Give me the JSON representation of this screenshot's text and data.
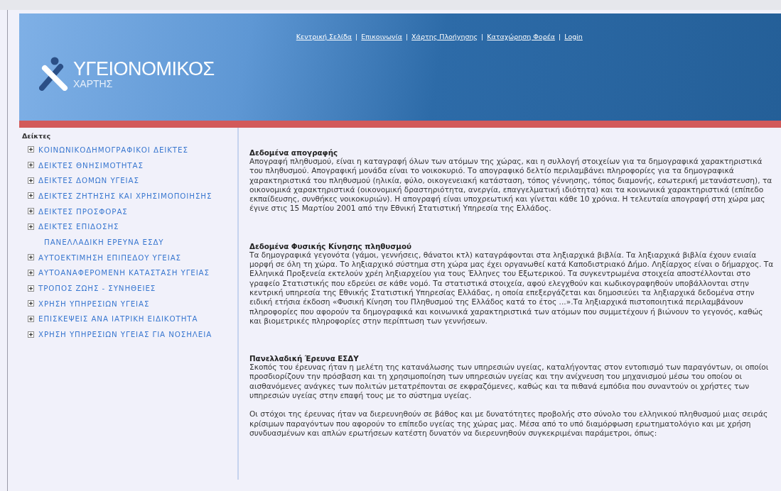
{
  "header": {
    "logo": {
      "title": "ΥΓΕΙΟΝΟΜΙΚΟΣ",
      "subtitle": "ΧΑΡΤΗΣ"
    },
    "nav": [
      {
        "label": "Κεντρική Σελίδα"
      },
      {
        "label": "Επικοινωνία"
      },
      {
        "label": "Χάρτης Πλοήγησης"
      },
      {
        "label": "Καταχώρηση Φορέα"
      },
      {
        "label": "Login"
      }
    ],
    "separator": "|"
  },
  "sidebar": {
    "title": "Δείκτες",
    "items": [
      {
        "kind": "group",
        "label": "ΚΟΙΝΩΝΙΚΟΔΗΜΟΓΡΑΦΙΚΟΙ ΔΕΙΚΤΕΣ",
        "expanded": false
      },
      {
        "kind": "group",
        "label": "ΔΕΙΚΤΕΣ ΘΝΗΣΙΜΟΤΗΤΑΣ",
        "expanded": false
      },
      {
        "kind": "group",
        "label": "ΔΕΙΚΤΕΣ ΔΟΜΩΝ ΥΓΕΙΑΣ",
        "expanded": false
      },
      {
        "kind": "group",
        "label": "ΔΕΙΚΤΕΣ ΖΗΤΗΣΗΣ ΚΑΙ ΧΡΗΣΙΜΟΠΟΙΗΣΗΣ",
        "expanded": false
      },
      {
        "kind": "group",
        "label": "ΔΕΙΚΤΕΣ ΠΡΟΣΦΟΡΑΣ",
        "expanded": false
      },
      {
        "kind": "group",
        "label": "ΔΕΙΚΤΕΣ ΕΠΙΔΟΣΗΣ",
        "expanded": false
      },
      {
        "kind": "leaf",
        "label": "ΠΑΝΕΛΛΑΔΙΚΗ ΕΡΕΥΝΑ ΕΣΔΥ"
      },
      {
        "kind": "group",
        "label": "ΑΥΤΟΕΚΤΙΜΗΣΗ ΕΠΙΠΕΔΟΥ ΥΓΕΙΑΣ",
        "expanded": false
      },
      {
        "kind": "group",
        "label": "ΑΥΤΟΑΝΑΦΕΡΟΜΕΝΗ ΚΑΤΑΣΤΑΣΗ ΥΓΕΙΑΣ",
        "expanded": false
      },
      {
        "kind": "group",
        "label": "ΤΡΟΠΟΣ ΖΩΗΣ - ΣΥΝΗΘΕΙΕΣ",
        "expanded": false
      },
      {
        "kind": "group",
        "label": "ΧΡΗΣΗ ΥΠΗΡΕΣΙΩΝ ΥΓΕΙΑΣ",
        "expanded": false
      },
      {
        "kind": "group",
        "label": "ΕΠΙΣΚΕΨΕΙΣ ΑΝΑ ΙΑΤΡΙΚΗ ΕΙΔΙΚΟΤΗΤΑ",
        "expanded": false
      },
      {
        "kind": "group",
        "label": "ΧΡΗΣΗ ΥΠΗΡΕΣΙΩΝ ΥΓΕΙΑΣ ΓΙΑ ΝΟΣΗΛΕΙΑ",
        "expanded": false
      }
    ]
  },
  "sections": [
    {
      "heading": "Δεδομένα απογραφής",
      "paragraphs": [
        "Απογραφή πληθυσμού, είναι η καταγραφή όλων των ατόμων της χώρας, και η συλλογή στοιχείων για τα δημογραφικά χαρακτηριστικά του πληθυσμού. Απογραφική μονάδα είναι το νοικοκυριό. Το απογραφικό δελτίο περιλαμβάνει πληροφορίες για τα δημογραφικά χαρακτηριστικά του πληθυσμού (ηλικία, φύλο, οικογενειακή κατάσταση, τόπος γέννησης, τόπος διαμονής, εσωτερική μετανάστευση), τα οικονομικά χαρακτηριστικά (οικονομική δραστηριότητα, ανεργία, επαγγελματική ιδιότητα) και τα κοινωνικά χαρακτηριστικά (επίπεδο εκπαίδευσης, συνθήκες νοικοκυριών). Η απογραφή είναι υποχρεωτική και γίνεται κάθε 10 χρόνια. Η τελευταία απογραφή στη χώρα μας έγινε στις 15 Μαρτίου 2001 από την Εθνική Στατιστική Υπηρεσία της Ελλάδος."
      ]
    },
    {
      "heading": "Δεδομένα Φυσικής Κίνησης πληθυσμού",
      "paragraphs": [
        "Τα δημογραφικά γεγονότα (γάμοι, γεννήσεις, θάνατοι κτλ) καταγράφονται στα ληξιαρχικά βιβλία. Τα ληξιαρχικά βιβλία έχουν ενιαία μορφή σε όλη τη χώρα. Το ληξιαρχικό σύστημα στη χώρα μας έχει οργανωθεί κατά Καποδιστριακό Δήμο. Ληξίαρχος είναι ο δήμαρχος. Τα Ελληνικά Προξενεία εκτελούν χρέη ληξιαρχείου για τους Έλληνες του Εξωτερικού. Τα συγκεντρωμένα στοιχεία αποστέλλονται στο γραφείο Στατιστικής που εδρεύει σε κάθε νομό. Τα στατιστικά στοιχεία, αφού ελεγχθούν και κωδικογραφηθούν υποβάλλονται στην κεντρική υπηρεσία της Εθνικής Στατιστική Υπηρεσίας Ελλάδας, η οποία επεξεργάζεται και δημοσιεύει τα ληξιαρχικά δεδομένα στην ειδική ετήσια έκδοση «Φυσική Κίνηση του Πληθυσμού της Ελλάδος κατά το έτος ...».Τα ληξιαρχικά πιστοποιητικά περιλαμβάνουν πληροφορίες που αφορούν τα δημογραφικά και κοινωνικά χαρακτηριστικά των ατόμων που συμμετέχουν ή βιώνουν το γεγονός, καθώς και βιομετρικές πληροφορίες στην περίπτωση των γεννήσεων."
      ]
    },
    {
      "heading": "Πανελλαδική Έρευνα ΕΣΔΥ",
      "paragraphs": [
        "Σκοπός του έρευνας ήταν η μελέτη της κατανάλωσης των υπηρεσιών υγείας, καταλήγοντας στον εντοπισμό των παραγόντων, οι οποίοι προσδιορίζουν την πρόσβαση και τη χρησιμοποίηση των υπηρεσιών υγείας και την ανίχνευση του μηχανισμού μέσω του οποίου οι αισθανόμενες ανάγκες των πολιτών μετατρέπονται σε εκφραζόμενες, καθώς και τα πιθανά εμπόδια που συναντούν οι χρήστες των υπηρεσιών υγείας στην επαφή τους με το σύστημα υγείας.",
        "Οι στόχοι της έρευνας ήταν να διερευνηθούν σε βάθος και με δυνατότητες προβολής στο σύνολο του ελληνικού πληθυσμού μιας σειράς κρίσιμων παραγόντων που αφορούν το επίπεδο υγείας της χώρας μας. Μέσα από το υπό διαμόρφωση ερωτηματολόγιο και με χρήση συνδυασμένων και απλών ερωτήσεων κατέστη δυνατόν να διερευνηθούν συγκεκριμέναι παράμετροι, όπως:"
      ]
    }
  ]
}
